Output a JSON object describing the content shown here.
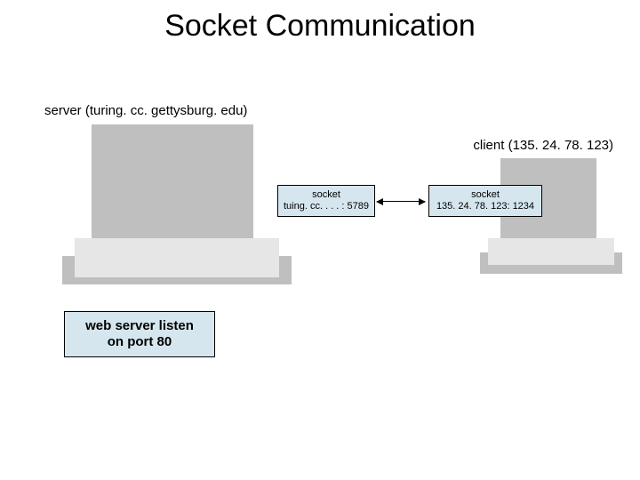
{
  "title": "Socket Communication",
  "server_label": "server (turing. cc. gettysburg. edu)",
  "client_label": "client (135. 24. 78. 123)",
  "server_socket": {
    "line1": "socket",
    "line2": "tuing. cc. . . . : 5789"
  },
  "client_socket": {
    "line1": "socket",
    "line2": "135. 24. 78. 123: 1234"
  },
  "webserver_box": {
    "line1": "web server listen",
    "line2": "on port 80"
  }
}
